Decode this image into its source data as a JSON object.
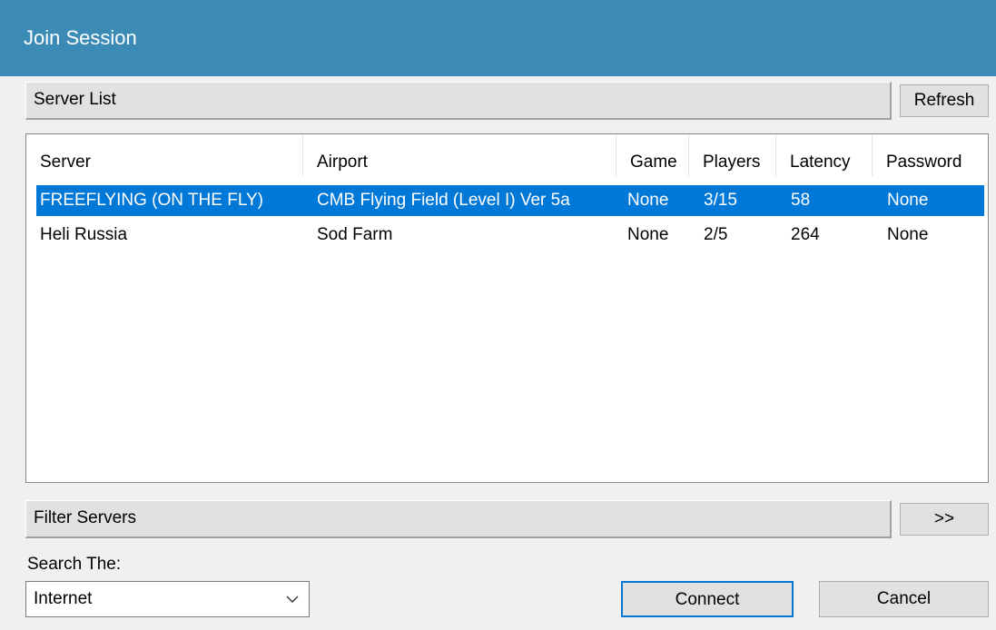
{
  "window": {
    "title": "Join Session"
  },
  "server_list_bar": {
    "label": "Server List",
    "refresh_label": "Refresh"
  },
  "server_table": {
    "columns": [
      "Server",
      "Airport",
      "Game",
      "Players",
      "Latency",
      "Password"
    ],
    "rows": [
      {
        "server": "FREEFLYING (ON THE FLY)",
        "airport": "CMB Flying Field (Level I) Ver 5a",
        "game": "None",
        "players": "3/15",
        "latency": "58",
        "password": "None",
        "selected": true
      },
      {
        "server": "Heli Russia",
        "airport": "Sod Farm",
        "game": "None",
        "players": "2/5",
        "latency": "264",
        "password": "None",
        "selected": false
      }
    ]
  },
  "filter_bar": {
    "label": "Filter Servers",
    "expand_label": ">>"
  },
  "search": {
    "label": "Search The:",
    "selected": "Internet"
  },
  "buttons": {
    "connect": "Connect",
    "cancel": "Cancel"
  },
  "colors": {
    "titlebar": "#3b8bb6",
    "selection": "#0078d7",
    "window_bg": "#f0f0f0"
  }
}
